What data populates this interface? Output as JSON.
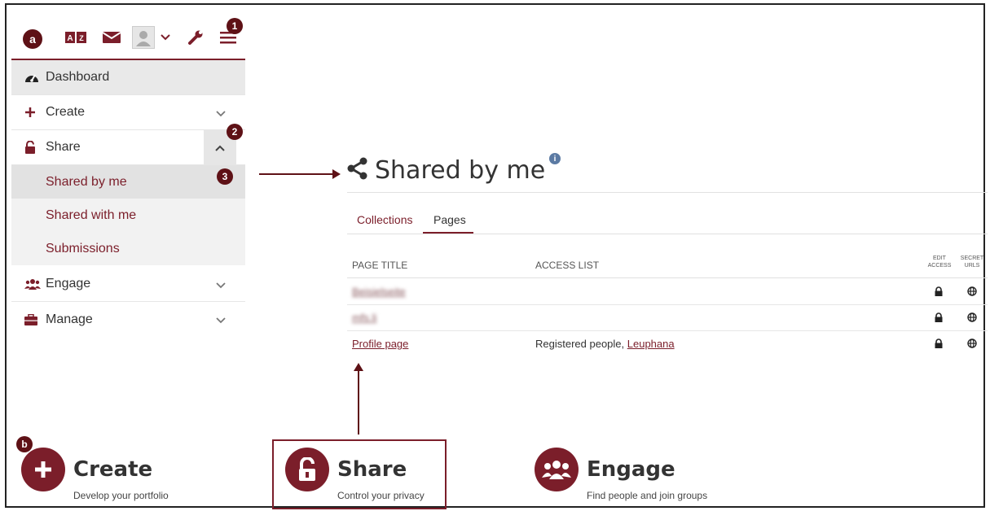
{
  "markers": {
    "a": "a",
    "b": "b",
    "one": "1",
    "two": "2",
    "three": "3"
  },
  "topbar": {
    "icons": [
      "translate-icon",
      "mail-icon",
      "user-avatar-icon",
      "chevron-down-icon",
      "wrench-icon",
      "menu-icon"
    ]
  },
  "sidebar": {
    "items": [
      {
        "label": "Dashboard",
        "icon": "dashboard-icon"
      },
      {
        "label": "Create",
        "icon": "plus-icon"
      },
      {
        "label": "Share",
        "icon": "unlock-icon"
      },
      {
        "label": "Engage",
        "icon": "users-icon"
      },
      {
        "label": "Manage",
        "icon": "briefcase-icon"
      }
    ],
    "share_sub": [
      "Shared by me",
      "Shared with me",
      "Submissions"
    ]
  },
  "panel": {
    "title": "Shared by me",
    "info": "i",
    "tabs": [
      "Collections",
      "Pages"
    ],
    "active_tab": "Pages",
    "columns": {
      "page_title": "PAGE TITLE",
      "access_list": "ACCESS LIST",
      "edit_access": "EDIT ACCESS",
      "secret_urls": "SECRET URLS"
    },
    "rows": [
      {
        "title": "Beisielseite",
        "access_pre": "",
        "access_link": ""
      },
      {
        "title": "mfs.li",
        "access_pre": "",
        "access_link": ""
      },
      {
        "title": "Profile page",
        "access_pre": "Registered people, ",
        "access_link": "Leuphana"
      }
    ]
  },
  "cards": [
    {
      "title": "Create",
      "subtitle": "Develop your portfolio",
      "icon": "plus-circle-icon"
    },
    {
      "title": "Share",
      "subtitle": "Control your privacy",
      "icon": "unlock-circle-icon"
    },
    {
      "title": "Engage",
      "subtitle": "Find people and join groups",
      "icon": "users-circle-icon"
    }
  ],
  "colors": {
    "accent": "#7b1e2a",
    "marker": "#5e1116",
    "info": "#5b7aa3"
  }
}
